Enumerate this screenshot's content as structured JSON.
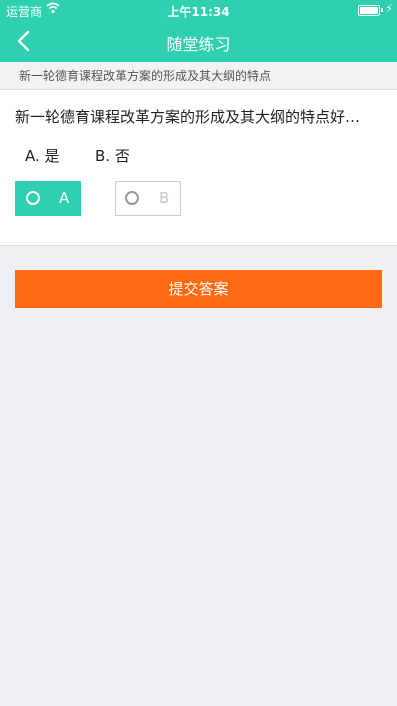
{
  "status_bar": {
    "carrier": "运营商",
    "time": "上午11:34",
    "wifi_icon": "wifi-icon",
    "battery_icon": "battery-icon"
  },
  "nav": {
    "title": "随堂练习",
    "back_icon": "chevron-left-icon"
  },
  "subheader": {
    "text": "新一轮德育课程改革方案的形成及其大纲的特点"
  },
  "question": {
    "text": "新一轮德育课程改革方案的形成及其大纲的特点好…",
    "options": [
      {
        "key": "A.",
        "label": "是"
      },
      {
        "key": "B.",
        "label": "否"
      }
    ]
  },
  "choices": [
    {
      "label": "A",
      "selected": true
    },
    {
      "label": "B",
      "selected": false
    }
  ],
  "submit_label": "提交答案",
  "colors": {
    "primary": "#2ed0b0",
    "submit": "#ff6a13",
    "background": "#efeff4"
  }
}
